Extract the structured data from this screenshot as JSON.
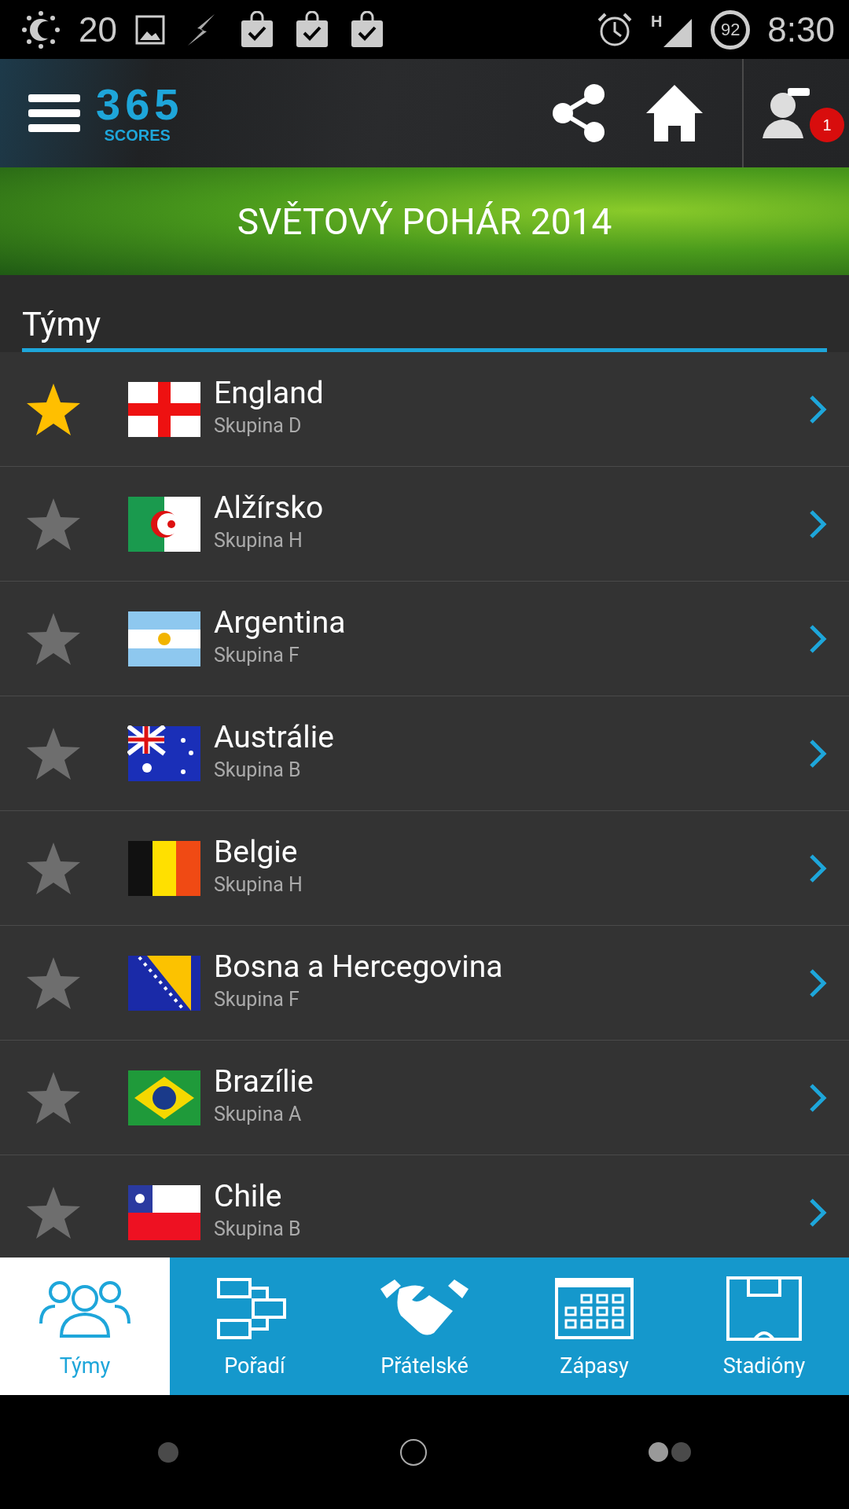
{
  "status_bar": {
    "brightness": "20",
    "network": "H",
    "battery": "92",
    "time": "8:30"
  },
  "header": {
    "logo_digits": [
      "3",
      "6",
      "5"
    ],
    "logo_word": "SCORES",
    "notification_count": "1"
  },
  "banner": {
    "title": "SVĚTOVÝ POHÁR 2014"
  },
  "section": {
    "title": "Týmy"
  },
  "teams": [
    {
      "name": "England",
      "group": "Skupina D",
      "favorite": true
    },
    {
      "name": "Alžírsko",
      "group": "Skupina H",
      "favorite": false
    },
    {
      "name": "Argentina",
      "group": "Skupina F",
      "favorite": false
    },
    {
      "name": "Austrálie",
      "group": "Skupina B",
      "favorite": false
    },
    {
      "name": "Belgie",
      "group": "Skupina H",
      "favorite": false
    },
    {
      "name": "Bosna a Hercegovina",
      "group": "Skupina F",
      "favorite": false
    },
    {
      "name": "Brazílie",
      "group": "Skupina A",
      "favorite": false
    },
    {
      "name": "Chile",
      "group": "Skupina B",
      "favorite": false
    }
  ],
  "tabs": [
    {
      "label": "Týmy",
      "kind": "teams",
      "selected": true
    },
    {
      "label": "Pořadí",
      "kind": "standings",
      "selected": false
    },
    {
      "label": "Přátelské",
      "kind": "friendly",
      "selected": false
    },
    {
      "label": "Zápasy",
      "kind": "matches",
      "selected": false
    },
    {
      "label": "Stadióny",
      "kind": "stadiums",
      "selected": false
    }
  ]
}
